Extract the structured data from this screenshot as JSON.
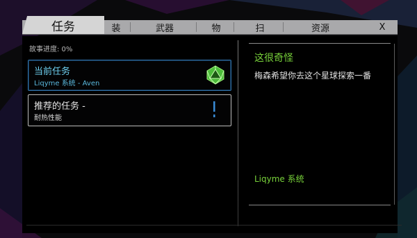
{
  "tabs": [
    {
      "label": "任务",
      "active": true
    },
    {
      "label": "装",
      "active": false
    },
    {
      "label": "武器",
      "active": false
    },
    {
      "label": "物",
      "active": false
    },
    {
      "label": "扫",
      "active": false
    },
    {
      "label": "资源",
      "active": false
    }
  ],
  "close_label": "X",
  "progress_label": "故事进度: 0%",
  "quests": {
    "current": {
      "title": "当前任务",
      "subtitle": "Liqyme 系统 - Aven",
      "icon": "d20-icon"
    },
    "recommended": {
      "title": "推荐的任务 -",
      "subtitle": "耐热性能",
      "icon": "alert-icon"
    }
  },
  "detail": {
    "title": "这很奇怪",
    "description": "梅森希望你去这个星球探索一番",
    "system": "Liqyme 系统"
  },
  "colors": {
    "accent_green": "#78d23a",
    "accent_blue": "#2f70a8",
    "tab_bar": "#a9a9ab"
  }
}
